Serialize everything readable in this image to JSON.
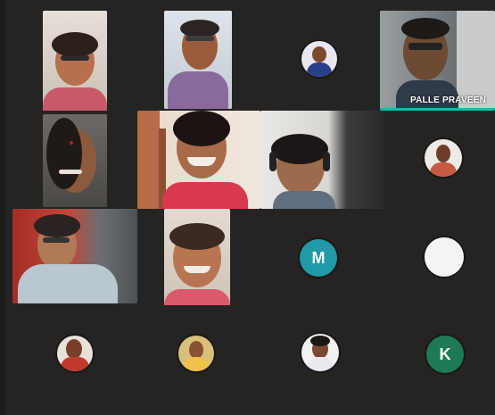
{
  "meeting": {
    "active_speaker_name": "PALLE PRAVEEN",
    "avatar_initials": [
      "M",
      "K"
    ]
  },
  "colors": {
    "background": "#252423",
    "active_speaker_underline": "#1fb8a6",
    "avatar_m": "#1f9aa6",
    "avatar_k": "#1d7a55",
    "avatar_blank": "#f4f4f4"
  }
}
